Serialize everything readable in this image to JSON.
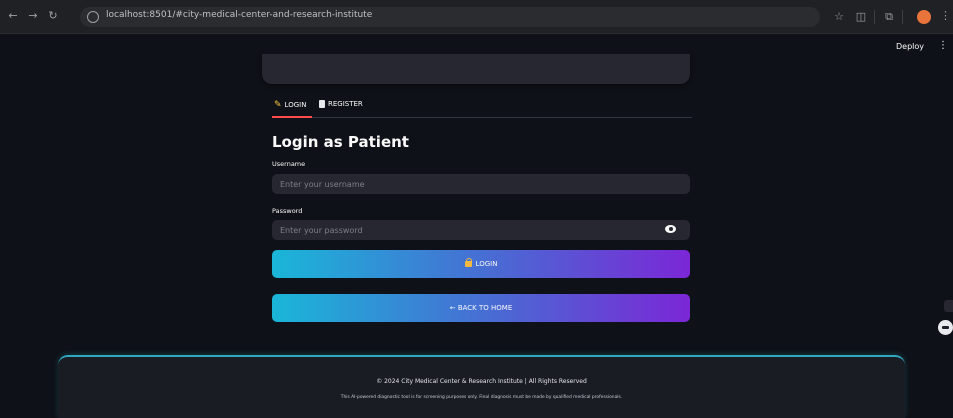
{
  "browser": {
    "url": "localhost:8501/#city-medical-center-and-research-institute"
  },
  "app": {
    "deploy_label": "Deploy",
    "menu_label": "⋮"
  },
  "tabs": {
    "login": "LOGIN",
    "register": "REGISTER"
  },
  "form": {
    "title": "Login as Patient",
    "username_label": "Username",
    "username_placeholder": "Enter your username",
    "password_label": "Password",
    "password_placeholder": "Enter your password"
  },
  "buttons": {
    "login": "LOGIN",
    "back_home": "← BACK TO HOME"
  },
  "footer": {
    "copyright": "© 2024 City Medical Center & Research Institute | All Rights Reserved",
    "disclaimer": "This AI-powered diagnostic tool is for screening purposes only. Final diagnosis must be made by qualified medical professionals."
  },
  "colors": {
    "background": "#0e1117",
    "accent_gradient_start": "#1ab6d8",
    "accent_gradient_end": "#7b27d6",
    "tab_underline": "#ff4b4b",
    "footer_border": "#2fa8c2"
  }
}
